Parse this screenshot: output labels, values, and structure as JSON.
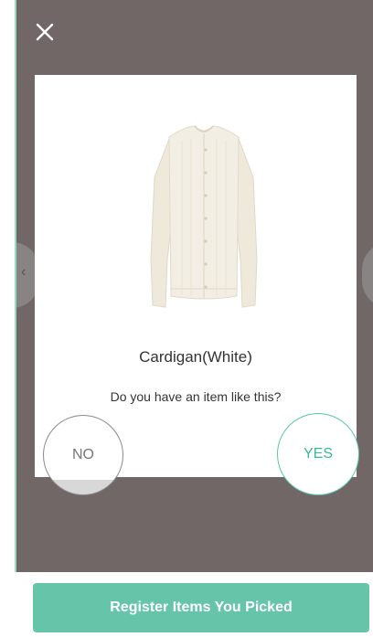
{
  "modal": {
    "close_icon": "close-icon",
    "product": {
      "name": "Cardigan(White)",
      "image": "white-cardigan-image"
    },
    "question": "Do you have an item like this?",
    "no_label": "NO",
    "yes_label": "YES",
    "prev_icon": "chevron-left-icon"
  },
  "footer": {
    "register_label": "Register Items You Picked"
  },
  "colors": {
    "overlay": "#716767",
    "accent": "#66c4a8",
    "yes_text": "#36b995"
  }
}
